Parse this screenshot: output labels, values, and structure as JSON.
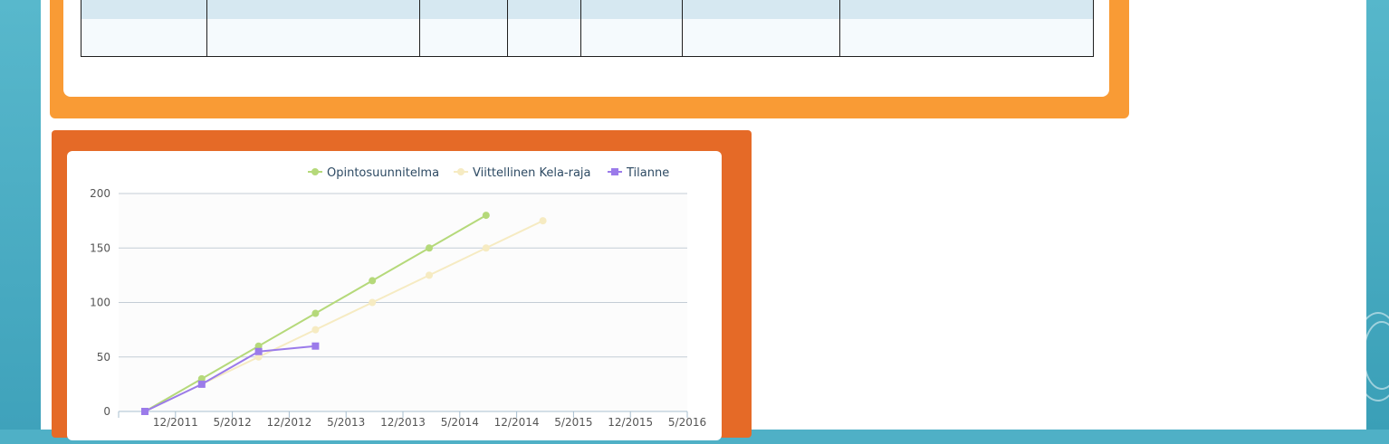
{
  "table": {
    "rows": [
      [
        "",
        "",
        "",
        "",
        "",
        "",
        ""
      ],
      [
        "",
        "",
        "",
        "",
        "",
        "",
        ""
      ]
    ]
  },
  "chart_data": {
    "type": "line",
    "title": "",
    "xlabel": "",
    "ylabel": "",
    "x": [
      "12/2011",
      "5/2012",
      "12/2012",
      "5/2013",
      "12/2013",
      "5/2014",
      "12/2014",
      "5/2015",
      "12/2015",
      "5/2016"
    ],
    "ylim": [
      0,
      200
    ],
    "yticks": [
      0,
      50,
      100,
      150,
      200
    ],
    "grid": true,
    "legend_position": "top-right",
    "series": [
      {
        "name": "Opintosuunnitelma",
        "color": "#b5d97a",
        "marker": "circle",
        "points": [
          [
            0,
            0
          ],
          [
            1,
            30
          ],
          [
            2,
            60
          ],
          [
            3,
            90
          ],
          [
            4,
            120
          ],
          [
            5,
            150
          ],
          [
            6,
            180
          ]
        ]
      },
      {
        "name": "Viittellinen Kela-raja",
        "color": "#f6ebc2",
        "marker": "circle",
        "points": [
          [
            0,
            0
          ],
          [
            1,
            25
          ],
          [
            2,
            50
          ],
          [
            3,
            75
          ],
          [
            4,
            100
          ],
          [
            5,
            125
          ],
          [
            6,
            150
          ],
          [
            7,
            175
          ]
        ]
      },
      {
        "name": "Tilanne",
        "color": "#9b7bea",
        "marker": "square",
        "points": [
          [
            0,
            0
          ],
          [
            1,
            25
          ],
          [
            2,
            55
          ],
          [
            3,
            60
          ]
        ]
      }
    ]
  }
}
